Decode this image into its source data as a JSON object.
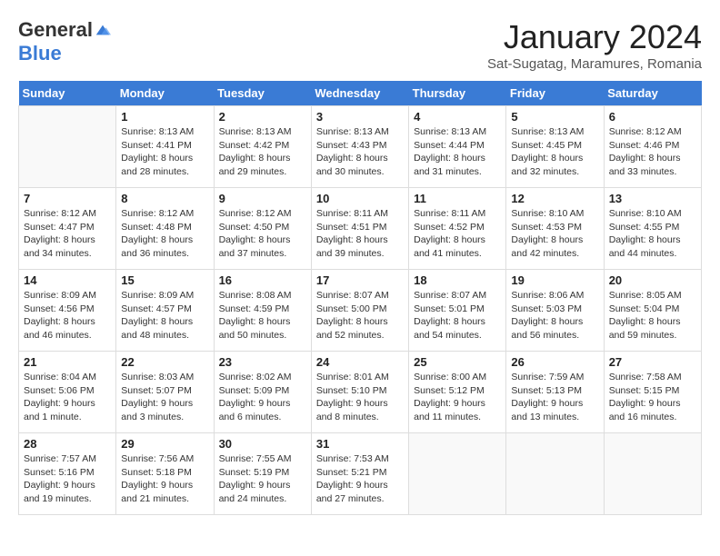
{
  "header": {
    "logo_general": "General",
    "logo_blue": "Blue",
    "month_title": "January 2024",
    "subtitle": "Sat-Sugatag, Maramures, Romania"
  },
  "days_of_week": [
    "Sunday",
    "Monday",
    "Tuesday",
    "Wednesday",
    "Thursday",
    "Friday",
    "Saturday"
  ],
  "weeks": [
    [
      {
        "day": "",
        "sunrise": "",
        "sunset": "",
        "daylight": ""
      },
      {
        "day": "1",
        "sunrise": "Sunrise: 8:13 AM",
        "sunset": "Sunset: 4:41 PM",
        "daylight": "Daylight: 8 hours and 28 minutes."
      },
      {
        "day": "2",
        "sunrise": "Sunrise: 8:13 AM",
        "sunset": "Sunset: 4:42 PM",
        "daylight": "Daylight: 8 hours and 29 minutes."
      },
      {
        "day": "3",
        "sunrise": "Sunrise: 8:13 AM",
        "sunset": "Sunset: 4:43 PM",
        "daylight": "Daylight: 8 hours and 30 minutes."
      },
      {
        "day": "4",
        "sunrise": "Sunrise: 8:13 AM",
        "sunset": "Sunset: 4:44 PM",
        "daylight": "Daylight: 8 hours and 31 minutes."
      },
      {
        "day": "5",
        "sunrise": "Sunrise: 8:13 AM",
        "sunset": "Sunset: 4:45 PM",
        "daylight": "Daylight: 8 hours and 32 minutes."
      },
      {
        "day": "6",
        "sunrise": "Sunrise: 8:12 AM",
        "sunset": "Sunset: 4:46 PM",
        "daylight": "Daylight: 8 hours and 33 minutes."
      }
    ],
    [
      {
        "day": "7",
        "sunrise": "Sunrise: 8:12 AM",
        "sunset": "Sunset: 4:47 PM",
        "daylight": "Daylight: 8 hours and 34 minutes."
      },
      {
        "day": "8",
        "sunrise": "Sunrise: 8:12 AM",
        "sunset": "Sunset: 4:48 PM",
        "daylight": "Daylight: 8 hours and 36 minutes."
      },
      {
        "day": "9",
        "sunrise": "Sunrise: 8:12 AM",
        "sunset": "Sunset: 4:50 PM",
        "daylight": "Daylight: 8 hours and 37 minutes."
      },
      {
        "day": "10",
        "sunrise": "Sunrise: 8:11 AM",
        "sunset": "Sunset: 4:51 PM",
        "daylight": "Daylight: 8 hours and 39 minutes."
      },
      {
        "day": "11",
        "sunrise": "Sunrise: 8:11 AM",
        "sunset": "Sunset: 4:52 PM",
        "daylight": "Daylight: 8 hours and 41 minutes."
      },
      {
        "day": "12",
        "sunrise": "Sunrise: 8:10 AM",
        "sunset": "Sunset: 4:53 PM",
        "daylight": "Daylight: 8 hours and 42 minutes."
      },
      {
        "day": "13",
        "sunrise": "Sunrise: 8:10 AM",
        "sunset": "Sunset: 4:55 PM",
        "daylight": "Daylight: 8 hours and 44 minutes."
      }
    ],
    [
      {
        "day": "14",
        "sunrise": "Sunrise: 8:09 AM",
        "sunset": "Sunset: 4:56 PM",
        "daylight": "Daylight: 8 hours and 46 minutes."
      },
      {
        "day": "15",
        "sunrise": "Sunrise: 8:09 AM",
        "sunset": "Sunset: 4:57 PM",
        "daylight": "Daylight: 8 hours and 48 minutes."
      },
      {
        "day": "16",
        "sunrise": "Sunrise: 8:08 AM",
        "sunset": "Sunset: 4:59 PM",
        "daylight": "Daylight: 8 hours and 50 minutes."
      },
      {
        "day": "17",
        "sunrise": "Sunrise: 8:07 AM",
        "sunset": "Sunset: 5:00 PM",
        "daylight": "Daylight: 8 hours and 52 minutes."
      },
      {
        "day": "18",
        "sunrise": "Sunrise: 8:07 AM",
        "sunset": "Sunset: 5:01 PM",
        "daylight": "Daylight: 8 hours and 54 minutes."
      },
      {
        "day": "19",
        "sunrise": "Sunrise: 8:06 AM",
        "sunset": "Sunset: 5:03 PM",
        "daylight": "Daylight: 8 hours and 56 minutes."
      },
      {
        "day": "20",
        "sunrise": "Sunrise: 8:05 AM",
        "sunset": "Sunset: 5:04 PM",
        "daylight": "Daylight: 8 hours and 59 minutes."
      }
    ],
    [
      {
        "day": "21",
        "sunrise": "Sunrise: 8:04 AM",
        "sunset": "Sunset: 5:06 PM",
        "daylight": "Daylight: 9 hours and 1 minute."
      },
      {
        "day": "22",
        "sunrise": "Sunrise: 8:03 AM",
        "sunset": "Sunset: 5:07 PM",
        "daylight": "Daylight: 9 hours and 3 minutes."
      },
      {
        "day": "23",
        "sunrise": "Sunrise: 8:02 AM",
        "sunset": "Sunset: 5:09 PM",
        "daylight": "Daylight: 9 hours and 6 minutes."
      },
      {
        "day": "24",
        "sunrise": "Sunrise: 8:01 AM",
        "sunset": "Sunset: 5:10 PM",
        "daylight": "Daylight: 9 hours and 8 minutes."
      },
      {
        "day": "25",
        "sunrise": "Sunrise: 8:00 AM",
        "sunset": "Sunset: 5:12 PM",
        "daylight": "Daylight: 9 hours and 11 minutes."
      },
      {
        "day": "26",
        "sunrise": "Sunrise: 7:59 AM",
        "sunset": "Sunset: 5:13 PM",
        "daylight": "Daylight: 9 hours and 13 minutes."
      },
      {
        "day": "27",
        "sunrise": "Sunrise: 7:58 AM",
        "sunset": "Sunset: 5:15 PM",
        "daylight": "Daylight: 9 hours and 16 minutes."
      }
    ],
    [
      {
        "day": "28",
        "sunrise": "Sunrise: 7:57 AM",
        "sunset": "Sunset: 5:16 PM",
        "daylight": "Daylight: 9 hours and 19 minutes."
      },
      {
        "day": "29",
        "sunrise": "Sunrise: 7:56 AM",
        "sunset": "Sunset: 5:18 PM",
        "daylight": "Daylight: 9 hours and 21 minutes."
      },
      {
        "day": "30",
        "sunrise": "Sunrise: 7:55 AM",
        "sunset": "Sunset: 5:19 PM",
        "daylight": "Daylight: 9 hours and 24 minutes."
      },
      {
        "day": "31",
        "sunrise": "Sunrise: 7:53 AM",
        "sunset": "Sunset: 5:21 PM",
        "daylight": "Daylight: 9 hours and 27 minutes."
      },
      {
        "day": "",
        "sunrise": "",
        "sunset": "",
        "daylight": ""
      },
      {
        "day": "",
        "sunrise": "",
        "sunset": "",
        "daylight": ""
      },
      {
        "day": "",
        "sunrise": "",
        "sunset": "",
        "daylight": ""
      }
    ]
  ]
}
